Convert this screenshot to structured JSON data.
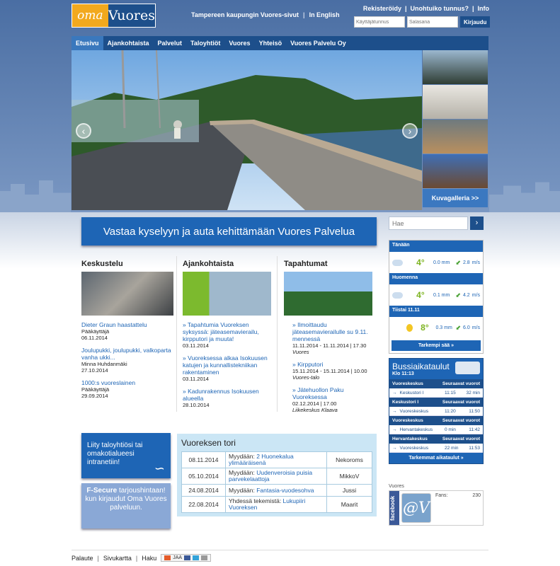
{
  "brand": {
    "oma": "oma",
    "vuores": "Vuores"
  },
  "toplinks": {
    "city": "Tampereen kaupungin Vuores-sivut",
    "english": "In English",
    "sep": "|"
  },
  "account": {
    "register": "Rekisteröidy",
    "forgot": "Unohtuiko tunnus?",
    "info": "Info",
    "sep": "|",
    "username_placeholder": "Käyttäjätunnus",
    "password_placeholder": "Salasana",
    "login": "Kirjaudu"
  },
  "nav": [
    "Etusivu",
    "Ajankohtaista",
    "Palvelut",
    "Taloyhtiöt",
    "Vuores",
    "Yhteisö",
    "Vuores Palvelu Oy"
  ],
  "gallery": {
    "label": "Kuvagalleria >>",
    "prev": "‹",
    "next": "›"
  },
  "banner": "Vastaa kyselyyn ja auta kehittämään Vuores Palvelua",
  "search": {
    "placeholder": "Hae",
    "button": "›"
  },
  "keskustelu": {
    "title": "Keskustelu",
    "items": [
      {
        "title": "Dieter Graun haastattelu",
        "author": "Pääkäyttäjä",
        "date": "06.11.2014"
      },
      {
        "title": "Joulupukki, joulupukki, valkoparta vanha ukki...",
        "author": "Minna Huhdanmäki",
        "date": "27.10.2014"
      },
      {
        "title": "1000:s vuoreslainen",
        "author": "Pääkäyttäjä",
        "date": "29.09.2014"
      }
    ]
  },
  "ajankohtaista": {
    "title": "Ajankohtaista",
    "items": [
      {
        "title": "» Tapahtumia Vuoreksen syksyssä: jäteasemavierailu, kirpputori ja muuta!",
        "date": "03.11.2014"
      },
      {
        "title": "» Vuoreksessa alkaa Isokuusen katujen ja kunnallistekniikan rakentaminen",
        "date": "03.11.2014"
      },
      {
        "title": "» Kadunrakennus Isokuusen alueella",
        "date": "28.10.2014"
      }
    ]
  },
  "tapahtumat": {
    "title": "Tapahtumat",
    "items": [
      {
        "title": "» Ilmoittaudu jäteasemavierailulle su 9.11. mennessä",
        "date": "11.11.2014 - 11.11.2014 | 17.30",
        "place": "Vuores"
      },
      {
        "title": "» Kirpputori",
        "date": "15.11.2014 - 15.11.2014 | 10.00",
        "place": "Vuores-talo"
      },
      {
        "title": "» Jätehuollon Paku Vuoreksessa",
        "date": "02.12.2014 | 17.00",
        "place": "Liikekeskus Klaava"
      }
    ]
  },
  "weather": {
    "days": [
      {
        "label": "Tänään",
        "temp": "4°",
        "rain": "0.0 mm",
        "wind": "2.8",
        "unit": "m/s"
      },
      {
        "label": "Huomenna",
        "temp": "4°",
        "rain": "0.1 mm",
        "wind": "4.2",
        "unit": "m/s"
      },
      {
        "label": "Tiistai 11.11",
        "temp": "8°",
        "rain": "0.3 mm",
        "wind": "6.0",
        "unit": "m/s"
      }
    ],
    "more": "Tarkempi sää »"
  },
  "bus": {
    "title": "Bussiaikataulut",
    "time": "Klo 11:13",
    "groups": [
      {
        "from": "Vuoreskeskus",
        "next": "Seuraavat vuorot",
        "to": "Keskustori I",
        "t1": "11:15",
        "t2": "32 min"
      },
      {
        "from": "Keskustori I",
        "next": "Seuraavat vuorot",
        "to": "Vuoreskeskus",
        "t1": "11:20",
        "t2": "11:50"
      },
      {
        "from": "Vuoreskeskus",
        "next": "Seuraavat vuorot",
        "to": "Hervantakeskus",
        "t1": "0 min",
        "t2": "11:42"
      },
      {
        "from": "Hervantakeskus",
        "next": "Seuraavat vuorot",
        "to": "Vuoreskeskus",
        "t1": "22 min",
        "t2": "11:53"
      }
    ],
    "more": "Tarkemmat aikataulut »",
    "arrow": "→"
  },
  "facebook": {
    "label": "Vuores",
    "side": "facebook",
    "fans_label": "Fans:",
    "fans": "230",
    "avatar": "@V"
  },
  "promo1": "Liity taloyhtiösi tai omakotialueesi intranetiin!",
  "promo2": {
    "a": "F-Secure",
    "b": " tarjoushintaan! kun kirjaudut Oma Vuores palveluun."
  },
  "tori": {
    "title": "Vuoreksen tori",
    "rows": [
      {
        "date": "08.11.2014",
        "prefix": "Myydään: ",
        "item": "2 Huonekalua ylimääräisenä",
        "user": "Nekoroms"
      },
      {
        "date": "05.10.2014",
        "prefix": "Myydään: ",
        "item": "Uudenveroisia puisia parvekelaattoja",
        "user": "MikkoV"
      },
      {
        "date": "24.08.2014",
        "prefix": "Myydään: ",
        "item": "Fantasia-vuodesohva",
        "user": "Jussi"
      },
      {
        "date": "22.08.2014",
        "prefix": "Yhdessä tekemistä: ",
        "item": "Lukupiiri Vuoreksen",
        "user": "Maarit"
      }
    ]
  },
  "footer": {
    "feedback": "Palaute",
    "sitemap": "Sivukartta",
    "search": "Haku",
    "share": "JAA",
    "sep": "|"
  },
  "colors": {
    "brand_blue": "#1d4f8b",
    "accent_blue": "#1e65b5",
    "orange": "#f2a91e"
  }
}
